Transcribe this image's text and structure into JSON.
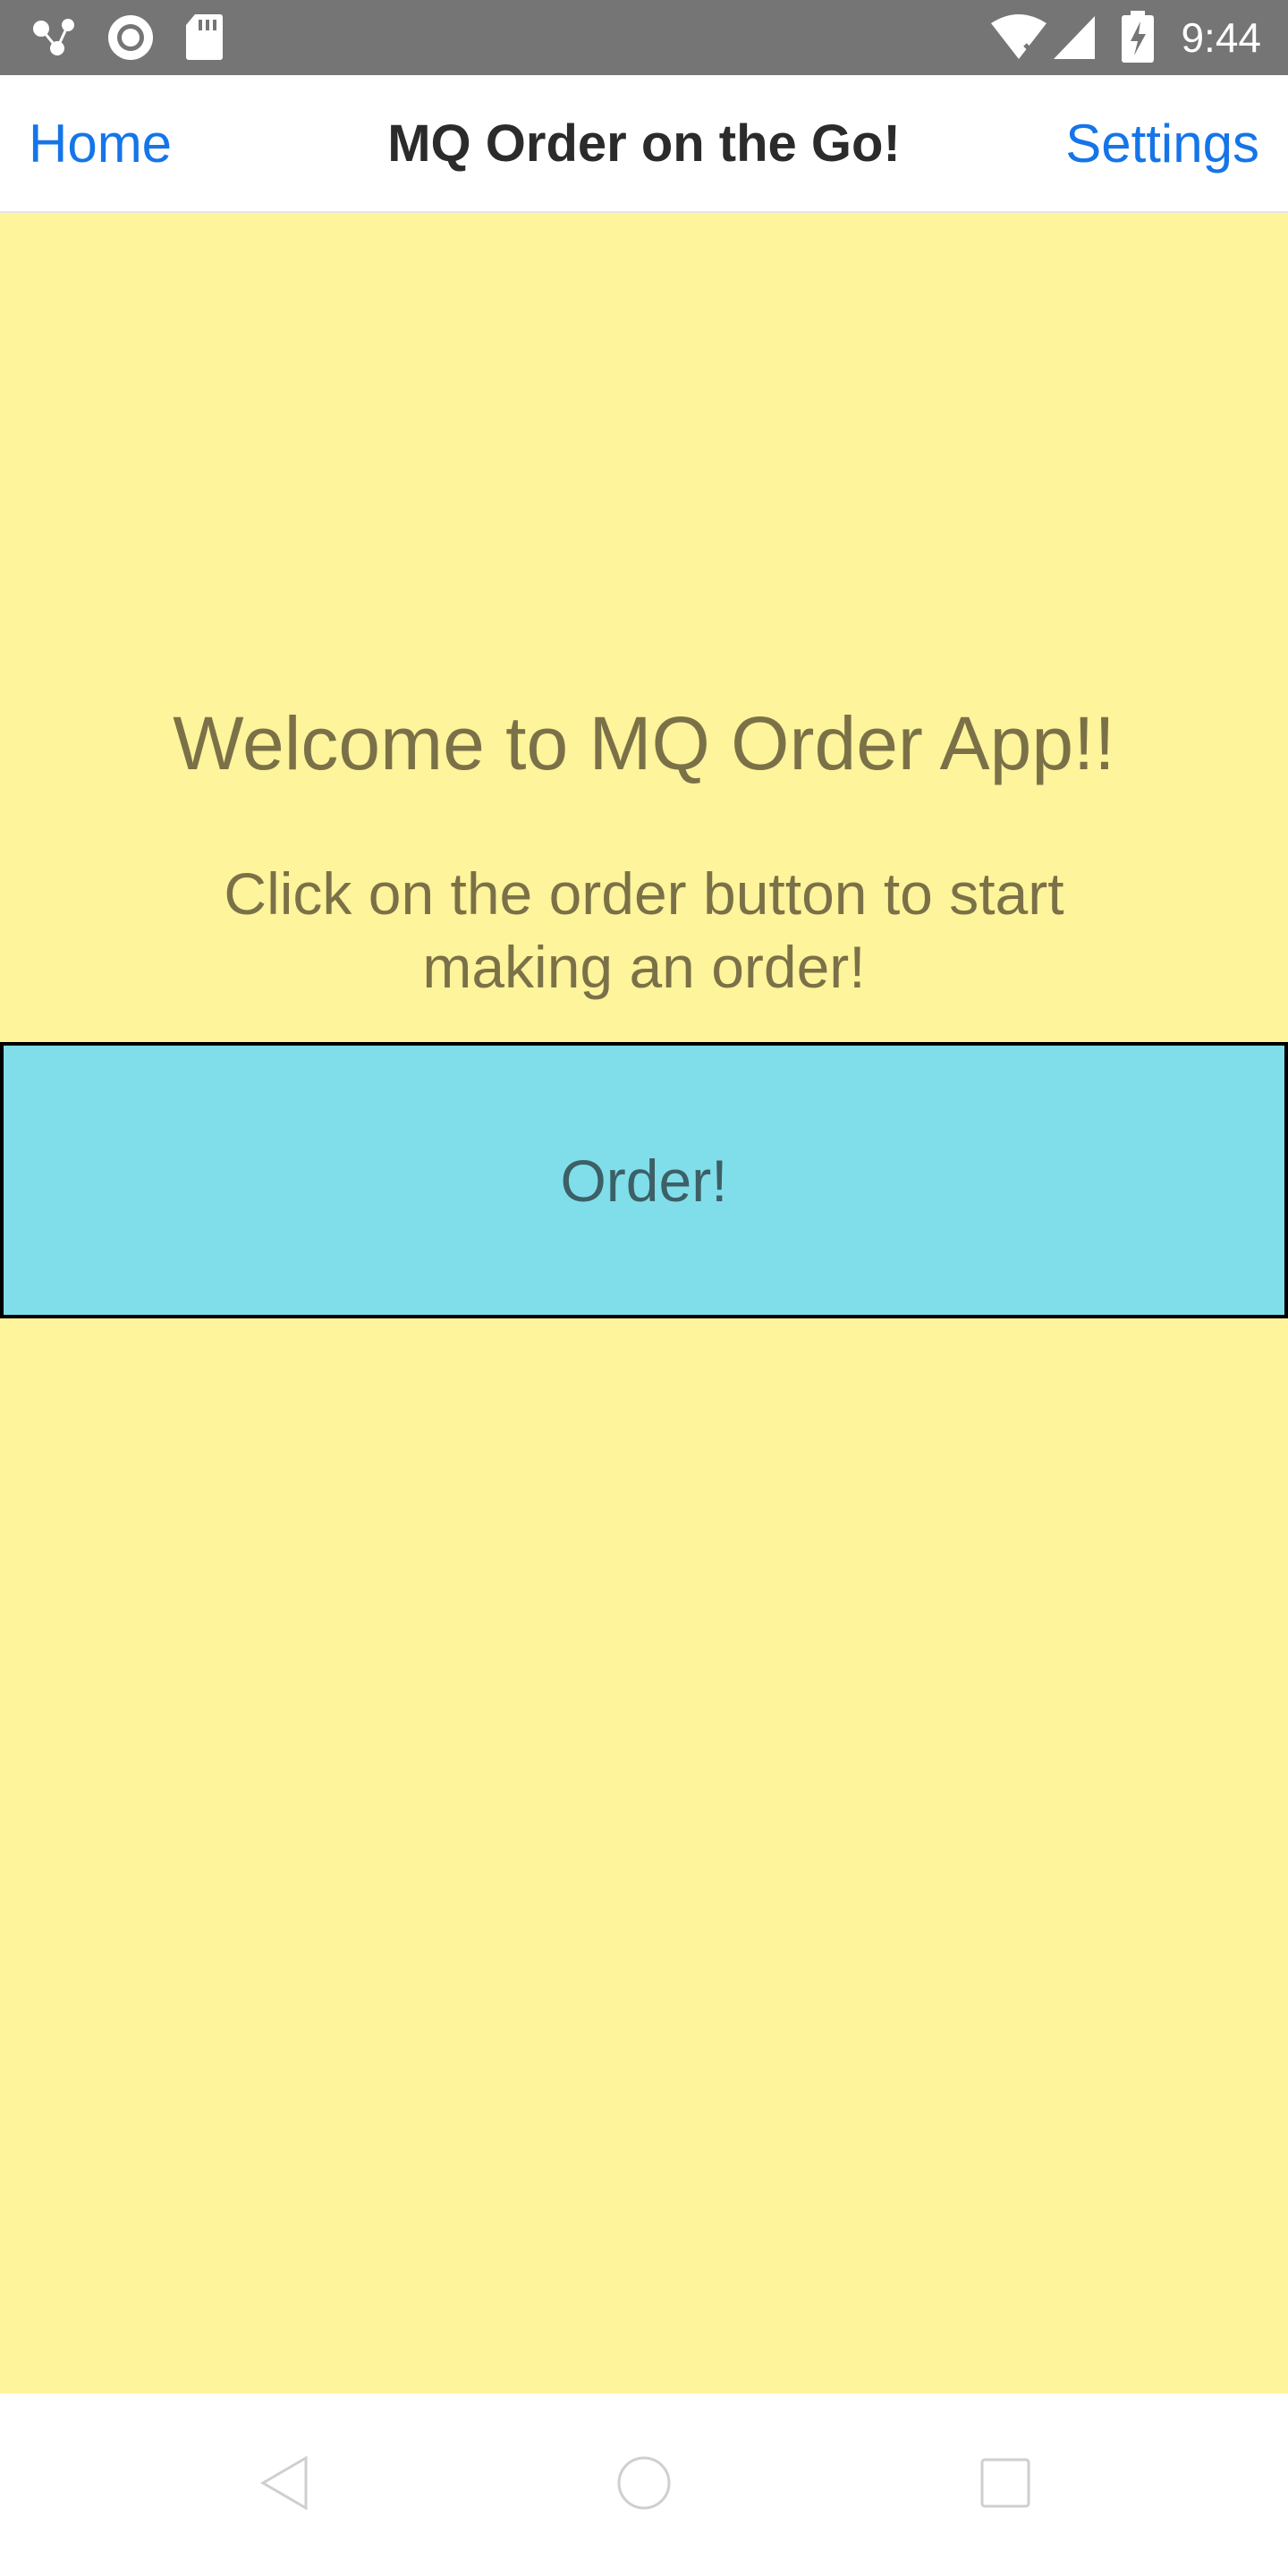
{
  "status_bar": {
    "time": "9:44",
    "icons_left": [
      "connection-dots-icon",
      "record-icon",
      "sd-card-icon"
    ],
    "icons_right": [
      "wifi-off-icon",
      "cell-signal-icon",
      "battery-charging-icon"
    ]
  },
  "nav": {
    "home_label": "Home",
    "title": "MQ Order on the Go!",
    "settings_label": "Settings",
    "link_color": "#1575E8"
  },
  "main": {
    "background_color": "#FEF49B",
    "welcome": "Welcome to MQ Order App!!",
    "instructions": "Click on the order button to start making an order!",
    "order_button_label": "Order!",
    "order_button_color": "#80DEEA"
  },
  "system_nav": {
    "icons": [
      "back-icon",
      "home-circle-icon",
      "recents-icon"
    ]
  }
}
